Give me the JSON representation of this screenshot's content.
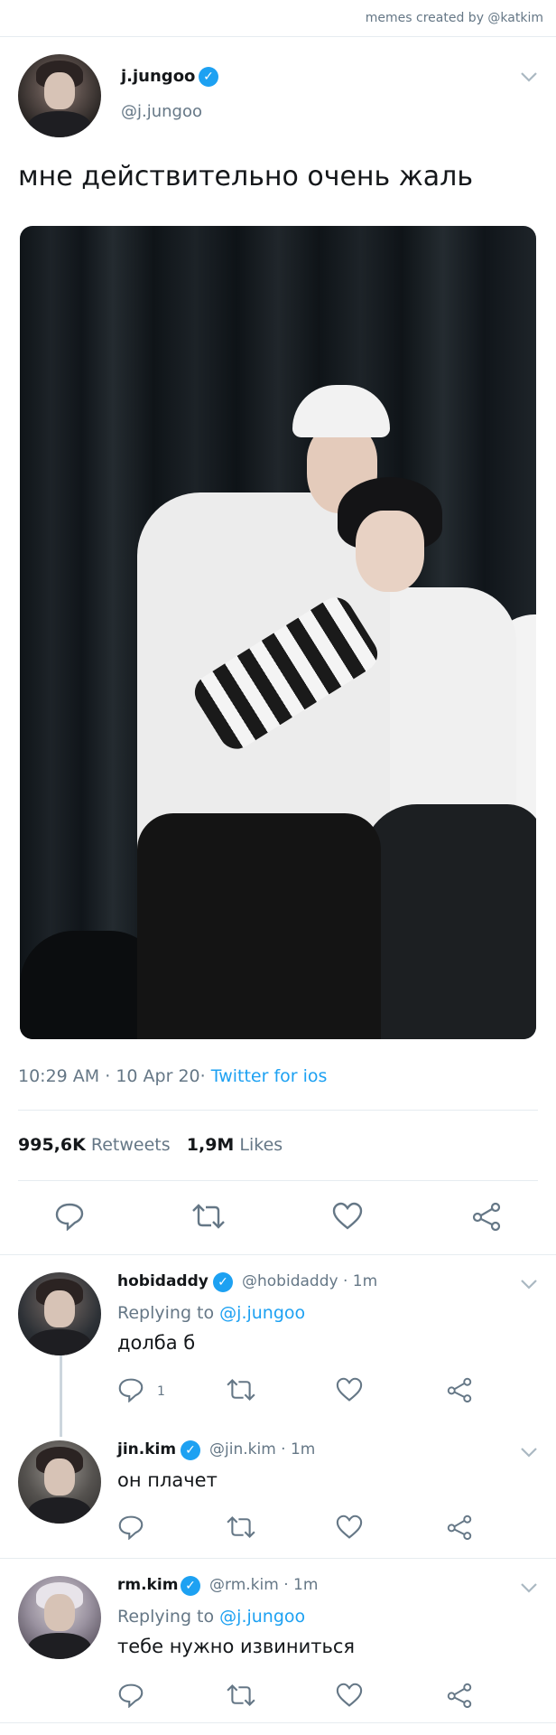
{
  "credit": "memes created by @katkim",
  "tweet": {
    "name": "j.jungoo",
    "handle": "@j.jungoo",
    "text": "мне действительно очень жаль",
    "time": "10:29 AM",
    "date": "10 Apr 20",
    "source": "Twitter for ios",
    "retweets_count": "995,6K",
    "retweets_label": "Retweets",
    "likes_count": "1,9M",
    "likes_label": "Likes"
  },
  "replies": [
    {
      "name": "hobidaddy",
      "handle": "@hobidaddy",
      "time": "1m",
      "replying_label": "Replying to",
      "replying_to": "@j.jungoo",
      "text": "долба б",
      "reply_count": "1"
    },
    {
      "name": "jin.kim",
      "handle": "@jin.kim",
      "time": "1m",
      "text": "он плачет"
    },
    {
      "name": "rm.kim",
      "handle": "@rm.kim",
      "time": "1m",
      "replying_label": "Replying to",
      "replying_to": "@j.jungoo",
      "text": "тебе нужно извиниться"
    }
  ],
  "separator": "·",
  "colors": {
    "accent": "#1da1f2",
    "muted": "#657786",
    "text": "#14171a",
    "divider": "#e6ecf0"
  },
  "icons": [
    "verified-badge-icon",
    "chevron-down-icon",
    "reply-icon",
    "retweet-icon",
    "like-icon",
    "share-icon"
  ]
}
